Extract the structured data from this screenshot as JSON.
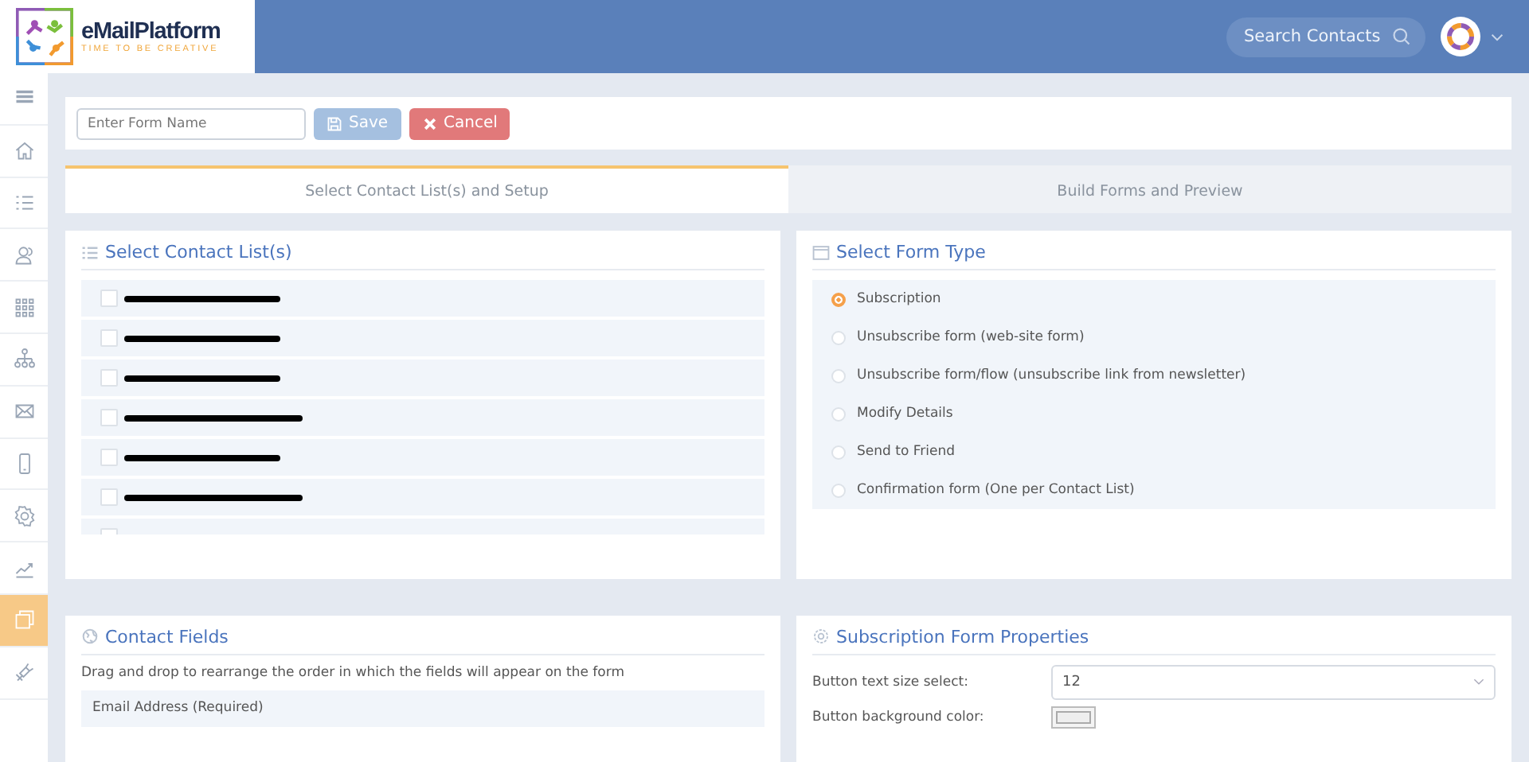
{
  "header": {
    "brand": "eMailPlatform",
    "tagline": "TIME TO BE CREATIVE",
    "search": {
      "placeholder": "Search Contacts"
    }
  },
  "sidebar": {
    "items": [
      {
        "kind": "menu",
        "selected": false
      },
      {
        "kind": "home",
        "selected": false
      },
      {
        "kind": "list",
        "selected": false
      },
      {
        "kind": "users",
        "selected": false
      },
      {
        "kind": "grid",
        "selected": false
      },
      {
        "kind": "hierarchy",
        "selected": false
      },
      {
        "kind": "mail",
        "selected": false
      },
      {
        "kind": "mobile",
        "selected": false
      },
      {
        "kind": "gear",
        "selected": false
      },
      {
        "kind": "chart",
        "selected": false
      },
      {
        "kind": "window",
        "selected": true
      },
      {
        "kind": "plug",
        "selected": false
      }
    ]
  },
  "toolbar": {
    "form_name": {
      "placeholder": "Enter Form Name"
    },
    "save": "Save",
    "cancel": "Cancel"
  },
  "tabs": [
    {
      "label": "Select Contact List(s) and Setup",
      "selected": true
    },
    {
      "label": "Build Forms and Preview",
      "selected": false
    }
  ],
  "contact_lists": {
    "title": "Select Contact List(s)",
    "items": [
      {
        "checked": false
      },
      {
        "checked": false
      },
      {
        "checked": false
      },
      {
        "checked": false
      },
      {
        "checked": false
      },
      {
        "checked": false
      },
      {
        "checked": false
      }
    ]
  },
  "form_type": {
    "title": "Select Form Type",
    "options": [
      {
        "label": "Subscription",
        "selected": true
      },
      {
        "label": "Unsubscribe form (web-site form)",
        "selected": false
      },
      {
        "label": "Unsubscribe form/flow (unsubscribe link from newsletter)",
        "selected": false
      },
      {
        "label": "Modify Details",
        "selected": false
      },
      {
        "label": "Send to Friend",
        "selected": false
      },
      {
        "label": "Confirmation form (One per Contact List)",
        "selected": false
      }
    ]
  },
  "contact_fields": {
    "title": "Contact Fields",
    "hint": "Drag and drop to rearrange the order in which the fields will appear on the form",
    "fields": [
      "Email Address (Required)"
    ]
  },
  "properties": {
    "title": "Subscription Form Properties",
    "text_size_label": "Button text size select:",
    "text_size_value": "12",
    "bg_color_label": "Button background color:"
  }
}
